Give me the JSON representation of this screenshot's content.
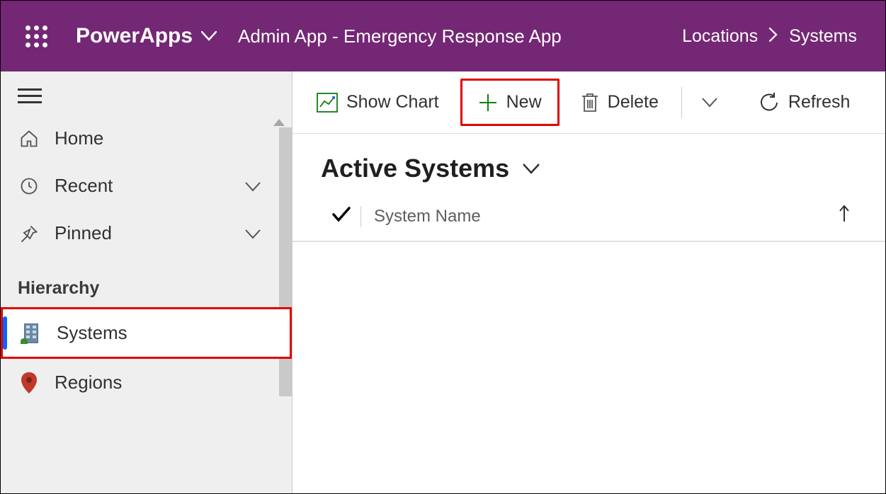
{
  "header": {
    "brand": "PowerApps",
    "app_title": "Admin App - Emergency Response App",
    "breadcrumb": [
      "Locations",
      "Systems"
    ]
  },
  "sidebar": {
    "nav": {
      "home": "Home",
      "recent": "Recent",
      "pinned": "Pinned"
    },
    "section_label": "Hierarchy",
    "items": [
      {
        "label": "Systems",
        "selected": true
      },
      {
        "label": "Regions",
        "selected": false
      }
    ]
  },
  "cmdbar": {
    "show_chart": "Show Chart",
    "new": "New",
    "delete": "Delete",
    "refresh": "Refresh"
  },
  "view": {
    "title": "Active Systems",
    "column": "System Name"
  },
  "colors": {
    "brand_purple": "#742774",
    "accent_green": "#107c10",
    "highlight_red": "#e30000"
  }
}
